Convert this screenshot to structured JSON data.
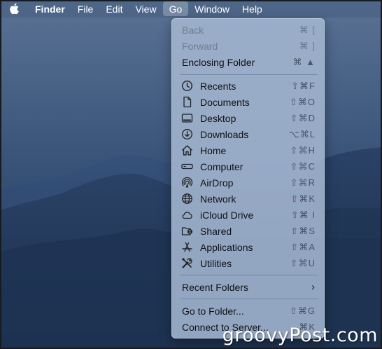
{
  "menubar": {
    "apple_icon": "apple-logo-icon",
    "app_name": "Finder",
    "items": [
      "File",
      "Edit",
      "View",
      "Go",
      "Window",
      "Help"
    ],
    "active_item": "Go"
  },
  "go_menu": {
    "nav": [
      {
        "label": "Back",
        "shortcut": "⌘ [",
        "enabled": false
      },
      {
        "label": "Forward",
        "shortcut": "⌘ ]",
        "enabled": false
      },
      {
        "label": "Enclosing Folder",
        "shortcut": "⌘ ▲",
        "enabled": true
      }
    ],
    "locations": [
      {
        "label": "Recents",
        "shortcut": "⇧⌘F",
        "icon": "clock-icon"
      },
      {
        "label": "Documents",
        "shortcut": "⇧⌘O",
        "icon": "document-icon"
      },
      {
        "label": "Desktop",
        "shortcut": "⇧⌘D",
        "icon": "desktop-icon"
      },
      {
        "label": "Downloads",
        "shortcut": "⌥⌘L",
        "icon": "download-icon"
      },
      {
        "label": "Home",
        "shortcut": "⇧⌘H",
        "icon": "home-icon"
      },
      {
        "label": "Computer",
        "shortcut": "⇧⌘C",
        "icon": "computer-icon"
      },
      {
        "label": "AirDrop",
        "shortcut": "⇧⌘R",
        "icon": "airdrop-icon"
      },
      {
        "label": "Network",
        "shortcut": "⇧⌘K",
        "icon": "globe-icon"
      },
      {
        "label": "iCloud Drive",
        "shortcut": "⇧⌘ I",
        "icon": "cloud-icon"
      },
      {
        "label": "Shared",
        "shortcut": "⇧⌘S",
        "icon": "shared-folder-icon"
      },
      {
        "label": "Applications",
        "shortcut": "⇧⌘A",
        "icon": "applications-icon"
      },
      {
        "label": "Utilities",
        "shortcut": "⇧⌘U",
        "icon": "utilities-icon"
      }
    ],
    "recent_folders": {
      "label": "Recent Folders",
      "submenu_icon": "chevron-right-icon"
    },
    "bottom": [
      {
        "label": "Go to Folder...",
        "shortcut": "⇧⌘G"
      },
      {
        "label": "Connect to Server...",
        "shortcut": "⌘K"
      }
    ]
  },
  "watermark": "groovyPost.com"
}
